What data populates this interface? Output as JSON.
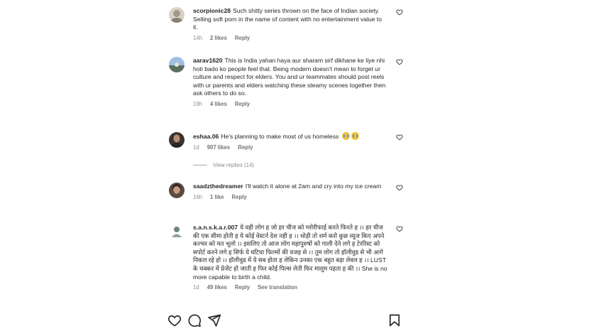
{
  "comments": [
    {
      "username": "scorpionic28",
      "text": "Such shitty series thrown on the face of Indian society. Selling soft porn in the name of content with no entertainment value to it.",
      "time": "14h",
      "likes": "2 likes",
      "reply": "Reply",
      "avatar_color": "#c9c2b8"
    },
    {
      "username": "aarav1620",
      "text": "This is India yahan haya aur sharam sirf dikhane ke liye nhi hoti bado ko people feel that. Being modern doesn't mean to forget ur culture and respect for elders. You and ur teammates should post reels with ur parents and elders watching these steamy scenes together then ask others to do so.",
      "time": "19h",
      "likes": "4 likes",
      "reply": "Reply",
      "avatar_color": "#8fb2d6"
    },
    {
      "username": "eshaa.06",
      "text": "He's planning to make most of us homeless",
      "time": "1d",
      "likes": "907 likes",
      "reply": "Reply",
      "avatar_color": "#3b3431"
    },
    {
      "username": "saadzthedreamer",
      "text": "I'll watch it alone at 2am and cry into my ice cream",
      "time": "16h",
      "likes": "1 like",
      "reply": "Reply",
      "avatar_color": "#4a3b33"
    },
    {
      "username": "s.a.n.s.k.a.r.007",
      "text": "ये वही लोग ह जो हर चीज को ग्लोरीफाई करते फिरते ह ।। हर चीज की एक सीमा होती ह ये कोई वेस्टर्न देश नही ह ।। थोड़ी तो शर्म करो कुछ व्यूज किए अपने कल्चर को मत भूलो ।। इसलिए तो आज लोग महापुरुषों को गाली देने लगे ह टेररिस्ट को सपोर्ट करने लगे ह सिर्फ ये घटिया फिल्मों की वजह से ।। तुम लोग तो हॉलीवुड से भी आगे निकल रहे हो ।। हॉलीवुड में ये सब होता ह लेकिन उनका एक बहुत बड़ा लेवल ह ।। LUST के चक्कर में प्रेजेंट हो जाती ह फिर कोई पिल्स लेती फिर मालूम पड़ता ह की ।। She is no more capable to birth a child.",
      "time": "1d",
      "likes": "49 likes",
      "reply": "Reply",
      "see_translation": "See translation",
      "avatar_color": "#7a8f8a"
    }
  ],
  "view_replies": "View replies (14)",
  "icons": {
    "like": "heart-icon",
    "comment": "comment-icon",
    "share": "share-icon",
    "save": "bookmark-icon"
  }
}
